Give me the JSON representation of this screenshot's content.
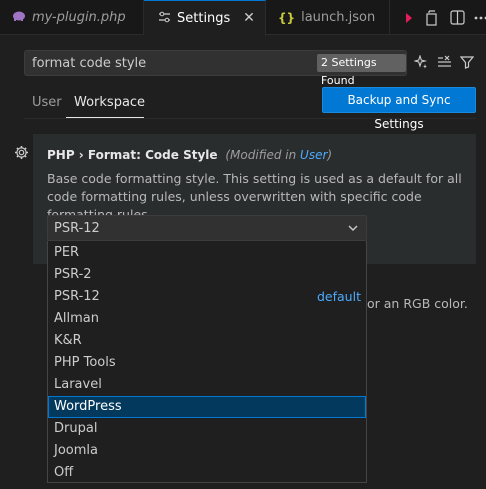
{
  "tabs": [
    {
      "label": "my-plugin.php",
      "icon": "elephant-icon",
      "active": false
    },
    {
      "label": "Settings",
      "icon": "settings-sliders-icon",
      "active": true
    },
    {
      "label": "launch.json",
      "icon": "json-braces-icon",
      "active": false
    }
  ],
  "search": {
    "value": "format code style",
    "results_badge": "2 Settings Found"
  },
  "scope_tabs": [
    "User",
    "Workspace"
  ],
  "sync_button": "Backup and Sync Settings",
  "setting": {
    "breadcrumb": "PHP › Format: ",
    "name": "Code Style",
    "modified_prefix": "(Modified in ",
    "modified_link": "User",
    "modified_suffix": ")",
    "description": "Base code formatting style. This setting is used as a default for all code formatting rules, unless overwritten with specific code formatting rules.",
    "current_value": "PSR-12"
  },
  "next_setting_fragment": "or an RGB color.",
  "dropdown": {
    "options": [
      "PER",
      "PSR-2",
      "PSR-12",
      "Allman",
      "K&R",
      "PHP Tools",
      "Laravel",
      "WordPress",
      "Drupal",
      "Joomla",
      "Off"
    ],
    "default_label": "default",
    "highlighted": "WordPress"
  },
  "colors": {
    "accent": "#0078d4",
    "link": "#4daafc",
    "selection": "#04395e"
  }
}
